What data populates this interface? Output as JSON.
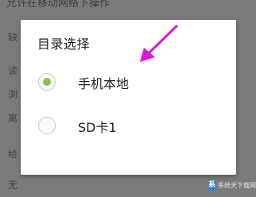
{
  "background": {
    "top_text": "允许在移动网络下操作",
    "side_chars": [
      "缺",
      "读",
      "浏",
      "离",
      "给",
      "无"
    ]
  },
  "dialog": {
    "title": "目录选择",
    "options": [
      {
        "label": "手机本地",
        "selected": true
      },
      {
        "label": "SD卡1",
        "selected": false
      }
    ],
    "accent_color": "#8bc34a"
  },
  "annotation": {
    "arrow_color": "#d81bd8"
  },
  "watermark": {
    "text": "系统天下载网"
  }
}
